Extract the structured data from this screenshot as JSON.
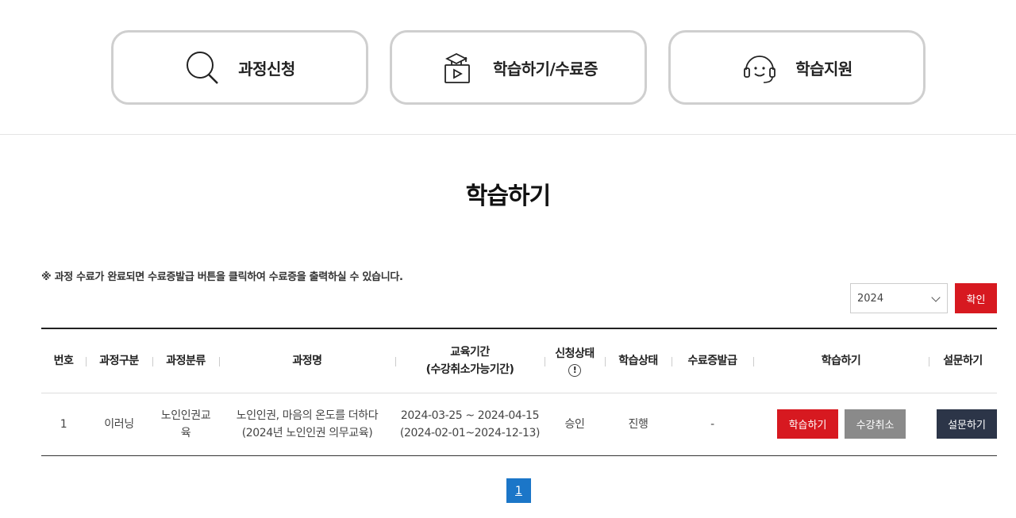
{
  "nav": {
    "apply_label": "과정신청",
    "study_label": "학습하기/수료증",
    "support_label": "학습지원"
  },
  "page_title": "학습하기",
  "notice": "※ 과정 수료가 완료되면 수료증발급 버튼을 클릭하여 수료증을 출력하실 수 있습니다.",
  "filter": {
    "year": "2024",
    "confirm_label": "확인",
    "accent_color": "#d71920"
  },
  "table": {
    "headers": {
      "no": "번호",
      "type": "과정구분",
      "category": "과정분류",
      "name": "과정명",
      "period_line1": "교육기간",
      "period_line2": "(수강취소가능기간)",
      "apply_status": "신청상태",
      "study_status": "학습상태",
      "certificate": "수료증발급",
      "study": "학습하기",
      "survey": "설문하기"
    },
    "rows": [
      {
        "no": "1",
        "type": "이러닝",
        "category_line1": "노인인권교",
        "category_line2": "육",
        "name_line1": "노인인권, 마음의 온도를 더하다",
        "name_line2": "(2024년 노인인권 의무교육)",
        "period_line1": "2024-03-25 ~ 2024-04-15",
        "period_line2": "(2024-02-01~2024-12-13)",
        "apply_status": "승인",
        "study_status": "진행",
        "certificate": "-",
        "study_button": "학습하기",
        "cancel_button": "수강취소",
        "survey_button": "설문하기"
      }
    ]
  },
  "pagination": {
    "current": "1",
    "active_color": "#1b76c8"
  }
}
